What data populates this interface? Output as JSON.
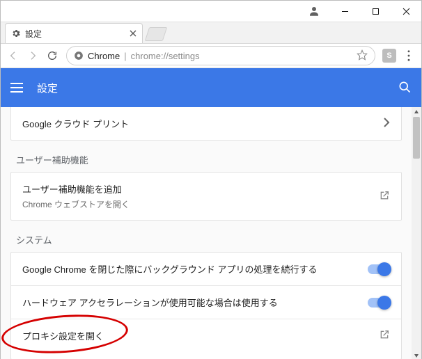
{
  "browser_tab": {
    "title": "設定"
  },
  "omnibox": {
    "origin": "Chrome",
    "url_rest": "chrome://settings"
  },
  "toolbar_ext_badge": "S",
  "page": {
    "title": "設定"
  },
  "cloud_print_row": {
    "title": "Google クラウド プリント"
  },
  "section_accessibility": "ユーザー補助機能",
  "accessibility_row": {
    "title": "ユーザー補助機能を追加",
    "subtitle": "Chrome ウェブストアを開く"
  },
  "section_system": "システム",
  "system_bg_row": {
    "title": "Google Chrome を閉じた際にバックグラウンド アプリの処理を続行する"
  },
  "system_hw_row": {
    "title": "ハードウェア アクセラレーションが使用可能な場合は使用する"
  },
  "system_proxy_row": {
    "title": "プロキシ設定を開く"
  }
}
